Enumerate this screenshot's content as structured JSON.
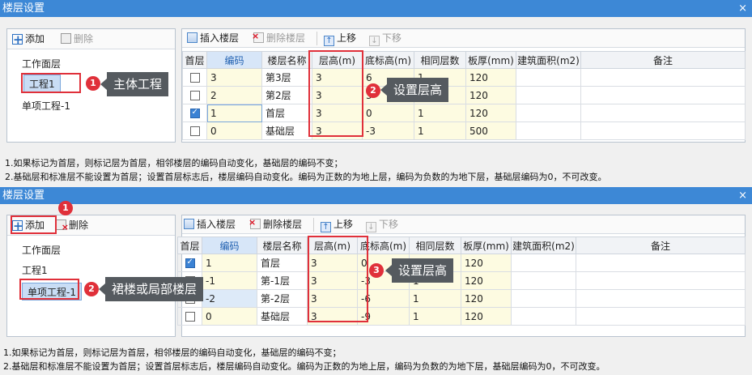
{
  "top": {
    "title": "楼层设置",
    "close": "×",
    "left_toolbar": {
      "add": "添加",
      "delete": "删除"
    },
    "tree": [
      "工作面层",
      "工程1",
      "单项工程-1"
    ],
    "toolbar": {
      "insert": "插入楼层",
      "delete": "删除楼层",
      "up": "上移",
      "down": "下移"
    },
    "columns": [
      "首层",
      "编码",
      "楼层名称",
      "层高(m)",
      "底标高(m)",
      "相同层数",
      "板厚(mm)",
      "建筑面积(m2)",
      "备注"
    ],
    "rows": [
      {
        "first": false,
        "code": "3",
        "name": "第3层",
        "height": "3",
        "bottom": "6",
        "same": "1",
        "slab": "120",
        "area": "",
        "note": ""
      },
      {
        "first": false,
        "code": "2",
        "name": "第2层",
        "height": "3",
        "bottom": "3",
        "same": "1",
        "slab": "120",
        "area": "",
        "note": ""
      },
      {
        "first": true,
        "code": "1",
        "name": "首层",
        "height": "3",
        "bottom": "0",
        "same": "1",
        "slab": "120",
        "area": "",
        "note": ""
      },
      {
        "first": false,
        "code": "0",
        "name": "基础层",
        "height": "3",
        "bottom": "-3",
        "same": "1",
        "slab": "500",
        "area": "",
        "note": ""
      }
    ],
    "notes": [
      "1.如果标记为首层，则标记层为首层，相邻楼层的编码自动变化，基础层的编码不变；",
      "2.基础层和标准层不能设置为首层；设置首层标志后，楼层编码自动变化。编码为正数的为地上层，编码为负数的为地下层，基础层编码为0，不可改变。"
    ],
    "annotations": [
      {
        "num": "1",
        "text": "主体工程"
      },
      {
        "num": "2",
        "text": "设置层高"
      }
    ]
  },
  "bottom": {
    "title": "楼层设置",
    "close": "×",
    "left_toolbar": {
      "add": "添加",
      "delete": "删除"
    },
    "tree": [
      "工作面层",
      "工程1",
      "单项工程-1"
    ],
    "toolbar": {
      "insert": "插入楼层",
      "delete": "删除楼层",
      "up": "上移",
      "down": "下移"
    },
    "columns": [
      "首层",
      "编码",
      "楼层名称",
      "层高(m)",
      "底标高(m)",
      "相同层数",
      "板厚(mm)",
      "建筑面积(m2)",
      "备注"
    ],
    "rows": [
      {
        "first": true,
        "code": "1",
        "name": "首层",
        "height": "3",
        "bottom": "0",
        "same": "1",
        "slab": "120",
        "area": "",
        "note": ""
      },
      {
        "first": false,
        "code": "-1",
        "name": "第-1层",
        "height": "3",
        "bottom": "-3",
        "same": "1",
        "slab": "120",
        "area": "",
        "note": ""
      },
      {
        "first": false,
        "code": "-2",
        "name": "第-2层",
        "height": "3",
        "bottom": "-6",
        "same": "1",
        "slab": "120",
        "area": "",
        "note": ""
      },
      {
        "first": false,
        "code": "0",
        "name": "基础层",
        "height": "3",
        "bottom": "-9",
        "same": "1",
        "slab": "120",
        "area": "",
        "note": ""
      }
    ],
    "notes": [
      "1.如果标记为首层，则标记层为首层，相邻楼层的编码自动变化，基础层的编码不变；",
      "2.基础层和标准层不能设置为首层；设置首层标志后，楼层编码自动变化。编码为正数的为地上层，编码为负数的为地下层，基础层编码为0，不可改变。"
    ],
    "annotations": [
      {
        "num": "1",
        "text": ""
      },
      {
        "num": "2",
        "text": "裙楼或局部楼层"
      },
      {
        "num": "3",
        "text": "设置层高"
      }
    ]
  }
}
